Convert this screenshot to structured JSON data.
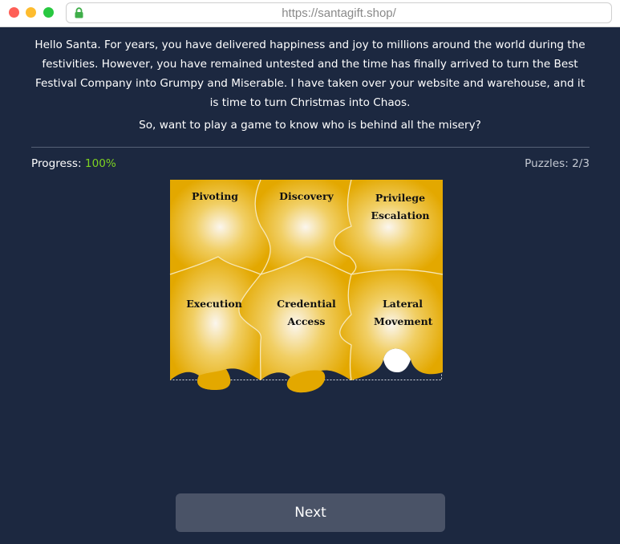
{
  "browser": {
    "url": "https://santagift.shop/",
    "lock_icon": "lock-icon",
    "window_controls": [
      "close",
      "minimize",
      "maximize"
    ]
  },
  "intro": {
    "paragraph": "Hello Santa. For years, you have delivered happiness and joy to millions around the world during the festivities. However, you have remained untested and the time has finally arrived to turn the Best Festival Company into Grumpy and Miserable. I have taken over your website and warehouse, and it is time to turn Christmas into Chaos.",
    "question": "So, want to play a game to know who is behind all the misery?"
  },
  "status": {
    "progress_label": "Progress:",
    "progress_value": "100%",
    "puzzles_label": "Puzzles: 2/3"
  },
  "puzzle": {
    "piece_color": "#e3a800",
    "pieces": [
      {
        "label": "Pivoting"
      },
      {
        "label": "Discovery"
      },
      {
        "label": "Privilege Escalation"
      },
      {
        "label": "Execution"
      },
      {
        "label": "Credential Access"
      },
      {
        "label": "Lateral Movement"
      }
    ]
  },
  "actions": {
    "next_label": "Next"
  },
  "colors": {
    "background": "#1c2840",
    "accent_green": "#7ed321",
    "button_bg": "#4a5367"
  }
}
